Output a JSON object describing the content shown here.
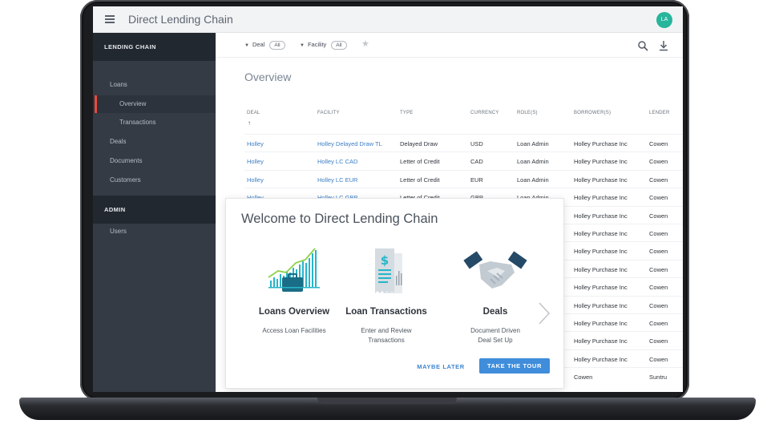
{
  "app": {
    "title": "Direct Lending Chain",
    "avatar_initials": "LA",
    "menu_icon": "hamburger-menu-icon"
  },
  "sidebar": {
    "section_lending": "LENDING CHAIN",
    "items": [
      {
        "label": "Loans"
      },
      {
        "label": "Overview",
        "active": true
      },
      {
        "label": "Transactions"
      },
      {
        "label": "Deals"
      },
      {
        "label": "Documents"
      },
      {
        "label": "Customers"
      }
    ],
    "section_admin": "ADMIN",
    "admin_items": [
      {
        "label": "Users"
      }
    ]
  },
  "filters": {
    "deal": {
      "label": "Deal",
      "value": "All"
    },
    "facility": {
      "label": "Facility",
      "value": "All"
    },
    "icons": [
      "star-icon",
      "search-icon",
      "download-icon"
    ]
  },
  "main": {
    "title": "Overview",
    "columns": [
      "DEAL",
      "FACILITY",
      "TYPE",
      "CURRENCY",
      "ROLE(S)",
      "BORROWER(S)",
      "LENDER"
    ],
    "sort_indicator": "↑",
    "rows": [
      {
        "deal": "Holley",
        "facility": "Holley Delayed Draw TL",
        "type": "Delayed Draw",
        "currency": "USD",
        "role": "Loan Admin",
        "borrower": "Holley Purchase Inc",
        "lender": "Cowen"
      },
      {
        "deal": "Holley",
        "facility": "Holley LC CAD",
        "type": "Letter of Credit",
        "currency": "CAD",
        "role": "Loan Admin",
        "borrower": "Holley Purchase Inc",
        "lender": "Cowen"
      },
      {
        "deal": "Holley",
        "facility": "Holley LC EUR",
        "type": "Letter of Credit",
        "currency": "EUR",
        "role": "Loan Admin",
        "borrower": "Holley Purchase Inc",
        "lender": "Cowen"
      },
      {
        "deal": "Holley",
        "facility": "Holley LC GBP",
        "type": "Letter of Credit",
        "currency": "GBP",
        "role": "Loan Admin",
        "borrower": "Holley Purchase Inc",
        "lender": "Cowen"
      },
      {
        "borrower": "Holley Purchase Inc",
        "lender": "Cowen"
      },
      {
        "borrower": "Holley Purchase Inc",
        "lender": "Cowen"
      },
      {
        "borrower": "Holley Purchase Inc",
        "lender": "Cowen"
      },
      {
        "borrower": "Holley Purchase Inc",
        "lender": "Cowen"
      },
      {
        "borrower": "Holley Purchase Inc",
        "lender": "Cowen"
      },
      {
        "borrower": "Holley Purchase Inc",
        "lender": "Cowen"
      },
      {
        "borrower": "Holley Purchase Inc",
        "lender": "Cowen"
      },
      {
        "borrower": "Holley Purchase Inc",
        "lender": "Cowen"
      },
      {
        "borrower": "Holley Purchase Inc",
        "lender": "Cowen"
      },
      {
        "borrower": "Cowen",
        "lender": "Suntru"
      }
    ]
  },
  "modal": {
    "title": "Welcome to Direct Lending Chain",
    "cards": [
      {
        "title": "Loans Overview",
        "desc_line1": "Access Loan Facilities",
        "desc_line2": "",
        "icon": "bar-chart-briefcase-icon"
      },
      {
        "title": "Loan Transactions",
        "desc_line1": "Enter and Review",
        "desc_line2": "Transactions",
        "icon": "receipt-dollar-icon"
      },
      {
        "title": "Deals",
        "desc_line1": "Document Driven",
        "desc_line2": "Deal Set Up",
        "icon": "handshake-icon"
      }
    ],
    "maybe_later": "MAYBE LATER",
    "take_tour": "TAKE THE TOUR",
    "next_icon": "chevron-right-icon"
  },
  "colors": {
    "accent": "#3f8ddb",
    "sidebar": "#343b45",
    "sidebar_section": "#222830",
    "active_indicator": "#e84a3b",
    "teal": "#27b5c9",
    "avatar": "#27b59c"
  }
}
